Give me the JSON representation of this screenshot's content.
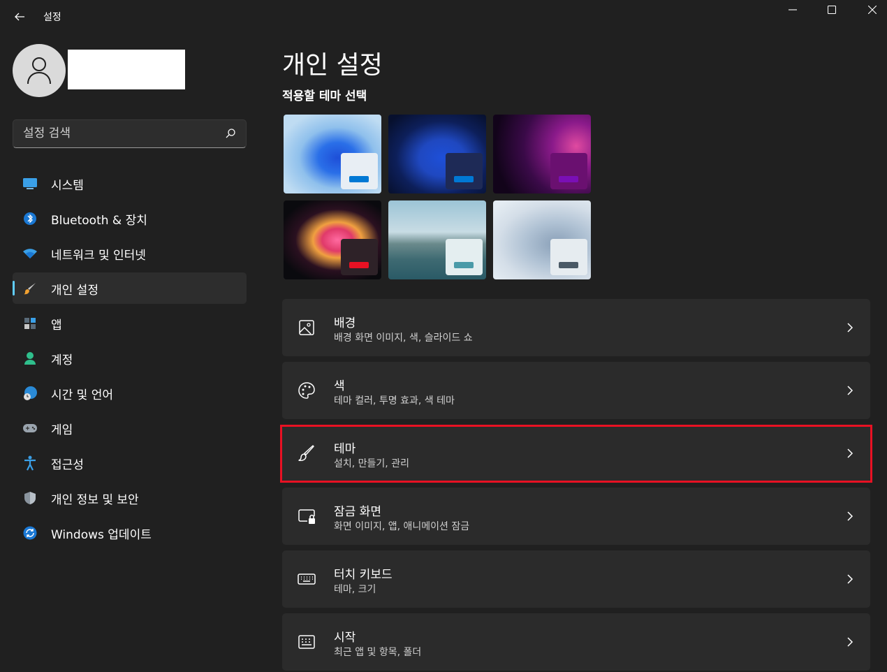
{
  "window": {
    "title": "설정",
    "back_icon": "back-arrow-icon",
    "controls": [
      "minimize-icon",
      "maximize-icon",
      "close-icon"
    ]
  },
  "user": {
    "avatar_icon": "user-avatar-icon",
    "name": ""
  },
  "search": {
    "placeholder": "설정 검색",
    "value": "",
    "icon": "search-icon"
  },
  "sidebar": {
    "active_color": "#60cdff",
    "items": [
      {
        "label": "시스템",
        "icon": "system-display-icon",
        "active": false
      },
      {
        "label": "Bluetooth & 장치",
        "icon": "bluetooth-icon",
        "active": false
      },
      {
        "label": "네트워크 및 인터넷",
        "icon": "wifi-icon",
        "active": false
      },
      {
        "label": "개인 설정",
        "icon": "paintbrush-icon",
        "active": true
      },
      {
        "label": "앱",
        "icon": "apps-icon",
        "active": false
      },
      {
        "label": "계정",
        "icon": "account-icon",
        "active": false
      },
      {
        "label": "시간 및 언어",
        "icon": "time-language-icon",
        "active": false
      },
      {
        "label": "게임",
        "icon": "gamepad-icon",
        "active": false
      },
      {
        "label": "접근성",
        "icon": "accessibility-icon",
        "active": false
      },
      {
        "label": "개인 정보 및 보안",
        "icon": "shield-icon",
        "active": false
      },
      {
        "label": "Windows 업데이트",
        "icon": "windows-update-icon",
        "active": false
      }
    ]
  },
  "main": {
    "title": "개인 설정",
    "theme_section_label": "적용할 테마 선택",
    "themes": [
      {
        "name": "theme-windows-light",
        "accent": "#0078d4"
      },
      {
        "name": "theme-windows-dark",
        "accent": "#0078d4"
      },
      {
        "name": "theme-glow",
        "accent": "#7a0fb5"
      },
      {
        "name": "theme-captured-motion",
        "accent": "#e81123"
      },
      {
        "name": "theme-sunrise",
        "accent": "#4a9aa8"
      },
      {
        "name": "theme-flow",
        "accent": "#4a5a66"
      }
    ],
    "cards": [
      {
        "title": "배경",
        "subtitle": "배경 화면 이미지, 색, 슬라이드 쇼",
        "icon": "image-icon",
        "highlighted": false
      },
      {
        "title": "색",
        "subtitle": "테마 컬러, 투명 효과, 색 테마",
        "icon": "palette-icon",
        "highlighted": false
      },
      {
        "title": "테마",
        "subtitle": "설치, 만들기, 관리",
        "icon": "brush-icon",
        "highlighted": true
      },
      {
        "title": "잠금 화면",
        "subtitle": "화면 이미지, 앱, 애니메이션 잠금",
        "icon": "lock-screen-icon",
        "highlighted": false
      },
      {
        "title": "터치 키보드",
        "subtitle": "테마, 크기",
        "icon": "keyboard-icon",
        "highlighted": false
      },
      {
        "title": "시작",
        "subtitle": "최근 앱 및 항목, 폴더",
        "icon": "start-menu-icon",
        "highlighted": false
      }
    ],
    "highlight_color": "#e81123"
  }
}
